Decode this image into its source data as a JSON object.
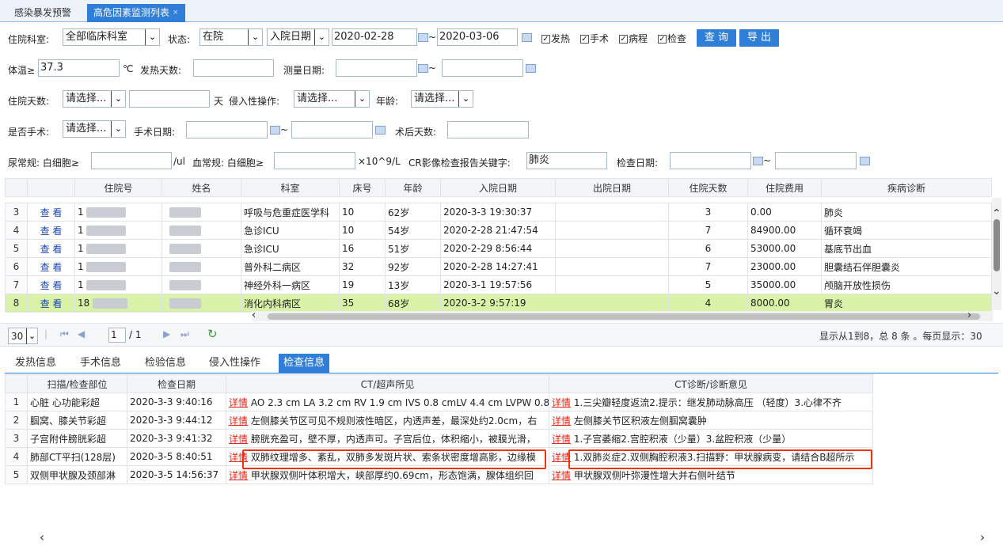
{
  "tabs": [
    {
      "label": "感染暴发预警"
    },
    {
      "label": "高危因素监测列表",
      "close": "×"
    }
  ],
  "filters": {
    "dept_label": "住院科室:",
    "dept_value": "全部临床科室",
    "status_label": "状态:",
    "status_value": "在院",
    "date_type_value": "入院日期",
    "date_from": "2020-02-28",
    "date_to": "2020-03-06",
    "tilde": "~",
    "checks": [
      {
        "label": "发热",
        "checked": true
      },
      {
        "label": "手术",
        "checked": true
      },
      {
        "label": "病程",
        "checked": true
      },
      {
        "label": "检查",
        "checked": true
      }
    ],
    "query_btn": "查 询",
    "export_btn": "导 出",
    "temp_label": "体温≥",
    "temp_value": "37.3",
    "temp_unit": "℃",
    "fever_days_label": "发热天数:",
    "measure_date_label": "测量日期:",
    "stay_days_label": "住院天数:",
    "stay_days_select": "请选择...",
    "days_unit": "天",
    "invasive_label": "侵入性操作:",
    "invasive_select": "请选择...",
    "age_label": "年龄:",
    "age_select": "请选择...",
    "surgery_label": "是否手术:",
    "surgery_select": "请选择...",
    "surgery_date_label": "手术日期:",
    "postop_days_label": "术后天数:",
    "urine_label": "尿常规: 白细胞≥",
    "urine_unit": "/ul",
    "blood_label": "血常规: 白细胞≥",
    "blood_unit": "×10^9/L",
    "cr_label": "CR影像检查报告关键字:",
    "cr_value": "肺炎",
    "exam_date_label": "检查日期:"
  },
  "patients": {
    "columns": [
      "",
      "",
      "住院号",
      "姓名",
      "科室",
      "床号",
      "年龄",
      "入院日期",
      "出院日期",
      "住院天数",
      "住院费用",
      "疾病诊断"
    ],
    "view_label": "查 看",
    "rows": [
      {
        "no": "3",
        "id": "1",
        "dept": "呼吸与危重症医学科",
        "bed": "10",
        "age": "62岁",
        "admit": "2020-3-3 19:30:37",
        "discharge": "",
        "days": "3",
        "cost": "0.00",
        "diag": "肺炎"
      },
      {
        "no": "4",
        "id": "1",
        "dept": "急诊ICU",
        "bed": "10",
        "age": "54岁",
        "admit": "2020-2-28 21:47:54",
        "discharge": "",
        "days": "7",
        "cost": "84900.00",
        "diag": "循环衰竭"
      },
      {
        "no": "5",
        "id": "1",
        "dept": "急诊ICU",
        "bed": "16",
        "age": "51岁",
        "admit": "2020-2-29 8:56:44",
        "discharge": "",
        "days": "6",
        "cost": "53000.00",
        "diag": "基底节出血"
      },
      {
        "no": "6",
        "id": "1",
        "dept": "普外科二病区",
        "bed": "32",
        "age": "92岁",
        "admit": "2020-2-28 14:27:41",
        "discharge": "",
        "days": "7",
        "cost": "23000.00",
        "diag": "胆囊结石伴胆囊炎"
      },
      {
        "no": "7",
        "id": "1",
        "dept": "神经外科一病区",
        "bed": "19",
        "age": "13岁",
        "admit": "2020-3-1 19:57:56",
        "discharge": "",
        "days": "5",
        "cost": "35000.00",
        "diag": "颅脑开放性损伤"
      },
      {
        "no": "8",
        "id": "18",
        "dept": "消化内科病区",
        "bed": "35",
        "age": "68岁",
        "admit": "2020-3-2 9:57:19",
        "discharge": "",
        "days": "4",
        "cost": "8000.00",
        "diag": "胃炎"
      }
    ]
  },
  "pager": {
    "page_size": "30",
    "page": "1",
    "total_pages": "/ 1",
    "summary": "显示从1到8，总 8 条 。每页显示：30"
  },
  "subtabs": [
    "发热信息",
    "手术信息",
    "检验信息",
    "侵入性操作",
    "检查信息"
  ],
  "exams": {
    "columns": [
      "",
      "扫描/检查部位",
      "检查日期",
      "CT/超声所见",
      "CT诊断/诊断意见"
    ],
    "detail_label": "详情",
    "rows": [
      {
        "no": "1",
        "part": "心脏 心功能彩超",
        "date": "2020-3-3 9:40:16",
        "finding": "AO 2.3 cm LA 3.2 cm RV 1.9 cm IVS 0.8 cmLV 4.4 cm LVPW 0.8",
        "diag": "1.三尖瓣轻度返流2.提示：继发肺动脉高压 （轻度）3.心律不齐"
      },
      {
        "no": "2",
        "part": "腘窝、膝关节彩超",
        "date": "2020-3-3 9:44:12",
        "finding": "左侧膝关节区可见不规则液性暗区，内透声差，最深处约2.0cm，右",
        "diag": "左侧膝关节区积液左侧腘窝囊肿"
      },
      {
        "no": "3",
        "part": "子宫附件膀胱彩超",
        "date": "2020-3-3 9:41:32",
        "finding": "膀胱充盈可，壁不厚，内透声可。子宫后位，体积缩小，被膜光滑，",
        "diag": "1.子宫萎缩2.宫腔积液（少量）3.盆腔积液（少量）"
      },
      {
        "no": "4",
        "part": "肺部CT平扫(128层)",
        "date": "2020-3-5 8:40:51",
        "finding": "双肺纹理增多、紊乱，双肺多发斑片状、索条状密度增高影，边缘模",
        "diag": "1.双肺炎症2.双侧胸腔积液3.扫描野：甲状腺病变，请结合B超所示"
      },
      {
        "no": "5",
        "part": "双侧甲状腺及颈部淋",
        "date": "2020-3-5 14:56:37",
        "finding": "甲状腺双侧叶体积增大，峡部厚约0.69cm，形态饱满，腺体组织回",
        "diag": "甲状腺双侧叶弥漫性增大并右侧叶结节"
      }
    ]
  }
}
